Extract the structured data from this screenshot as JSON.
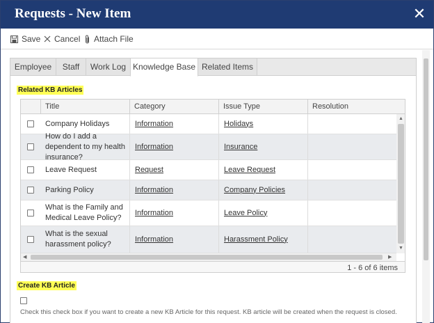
{
  "dialog": {
    "title": "Requests - New Item",
    "close_glyph": "✕"
  },
  "toolbar": {
    "save_label": "Save",
    "cancel_label": "Cancel",
    "attach_label": "Attach File",
    "icons": {
      "save": "floppy-disk-icon",
      "cancel": "x-icon",
      "attach": "paperclip-icon"
    }
  },
  "tabs": [
    {
      "label": "Employee",
      "active": false
    },
    {
      "label": "Staff",
      "active": false
    },
    {
      "label": "Work Log",
      "active": false
    },
    {
      "label": "Knowledge Base",
      "active": true
    },
    {
      "label": "Related Items",
      "active": false
    }
  ],
  "related_section": {
    "label": "Related KB Articles"
  },
  "grid": {
    "columns": [
      "",
      "Title",
      "Category",
      "Issue Type",
      "Resolution"
    ],
    "rows": [
      {
        "title": "Company Holidays",
        "category": "Information",
        "issue_type": "Holidays",
        "resolution": ""
      },
      {
        "title": "How do I add a dependent to my health insurance?",
        "category": "Information",
        "issue_type": "Insurance",
        "resolution": ""
      },
      {
        "title": "Leave Request",
        "category": "Request",
        "issue_type": "Leave Request",
        "resolution": ""
      },
      {
        "title": "Parking Policy",
        "category": "Information",
        "issue_type": "Company Policies",
        "resolution": ""
      },
      {
        "title": "What is the Family and Medical Leave Policy?",
        "category": "Information",
        "issue_type": "Leave Policy",
        "resolution": ""
      },
      {
        "title": "What is the sexual harassment policy?",
        "category": "Information",
        "issue_type": "Harassment Policy",
        "resolution": ""
      }
    ],
    "pager_text": "1 - 6 of 6 items"
  },
  "create_section": {
    "label": "Create KB Article",
    "hint": "Check this check box if you want to create a new KB Article for this request. KB article will be created when the request is closed."
  },
  "colors": {
    "titlebar": "#1f3b73",
    "highlight": "#ffff55",
    "alt_row": "#e9ebee"
  }
}
